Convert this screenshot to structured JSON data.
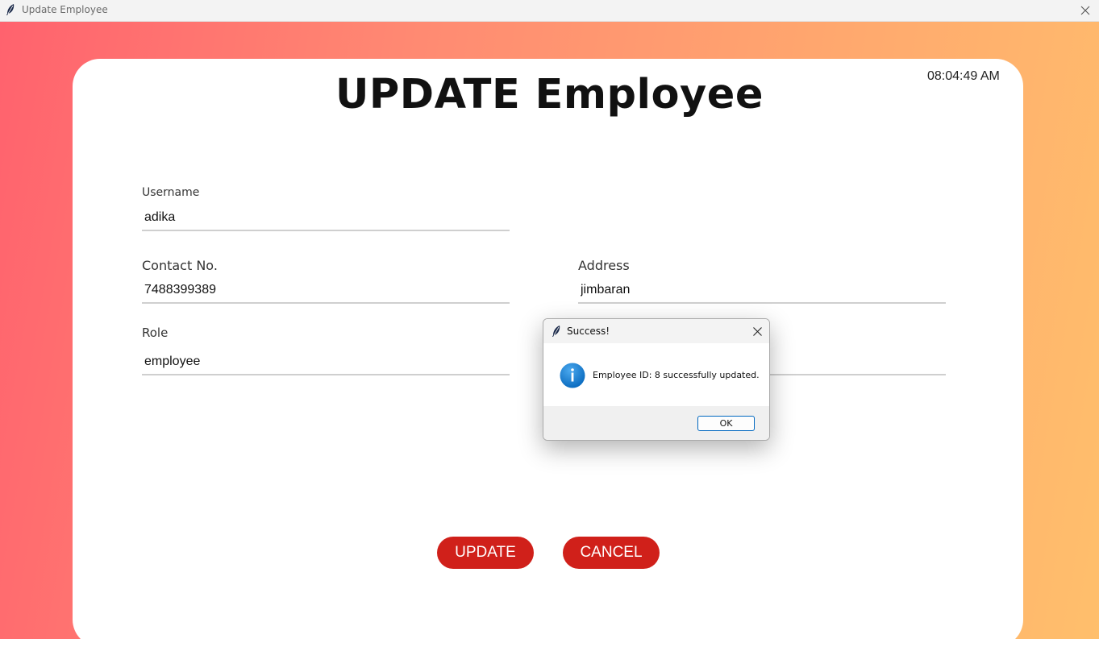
{
  "window": {
    "title": "Update Employee"
  },
  "clock": "08:04:49 AM",
  "heading": "UPDATE Employee",
  "form": {
    "username": {
      "label": "Username",
      "value": "adika"
    },
    "contact": {
      "label": "Contact No.",
      "value": "7488399389"
    },
    "address": {
      "label": "Address",
      "value": "jimbaran"
    },
    "role": {
      "label": "Role",
      "value": "employee"
    },
    "hidden_field": {
      "value": ""
    }
  },
  "buttons": {
    "update": "UPDATE",
    "cancel": "CANCEL"
  },
  "dialog": {
    "title": "Success!",
    "message": "Employee ID: 8 successfully updated.",
    "ok": "OK"
  },
  "colors": {
    "accent": "#d0201a",
    "gradient_left": "#ff626e",
    "gradient_right": "#ffbf6c",
    "info_icon": "#1a82d6"
  },
  "icons": {
    "app": "feather-icon",
    "close": "close-icon",
    "info": "info-icon"
  }
}
